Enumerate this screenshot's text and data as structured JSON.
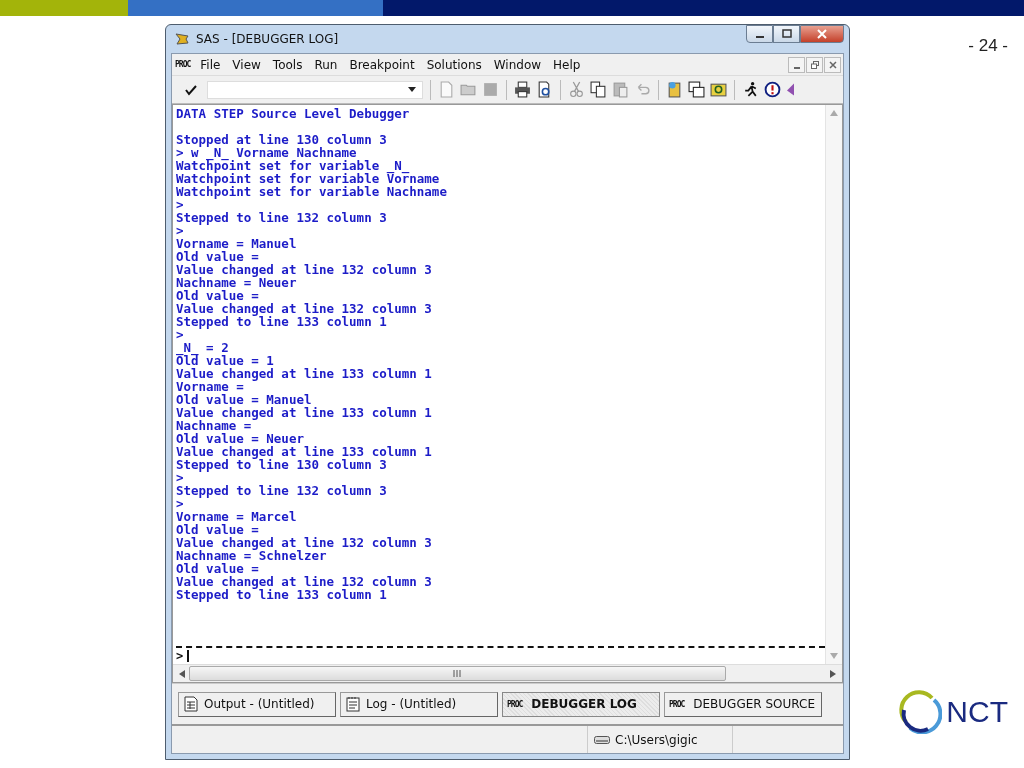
{
  "slide": {
    "page_number": "- 24 -",
    "logo_text": "NCT"
  },
  "window": {
    "title": "SAS - [DEBUGGER LOG]"
  },
  "menu": {
    "icon_label": "PROC",
    "items": [
      "File",
      "View",
      "Tools",
      "Run",
      "Breakpoint",
      "Solutions",
      "Window",
      "Help"
    ]
  },
  "log": {
    "header": "DATA STEP Source Level Debugger",
    "lines": [
      "Stopped at line 130 column 3",
      "> w _N_ Vorname Nachname",
      "Watchpoint set for variable _N_",
      "Watchpoint set for variable Vorname",
      "Watchpoint set for variable Nachname",
      ">",
      "Stepped to line 132 column 3",
      ">",
      "Vorname = Manuel",
      "Old value =",
      "Value changed at line 132 column 3",
      "Nachname = Neuer",
      "Old value =",
      "Value changed at line 132 column 3",
      "Stepped to line 133 column 1",
      ">",
      "_N_ = 2",
      "Old value = 1",
      "Value changed at line 133 column 1",
      "Vorname =",
      "Old value = Manuel",
      "Value changed at line 133 column 1",
      "Nachname =",
      "Old value = Neuer",
      "Value changed at line 133 column 1",
      "Stepped to line 130 column 3",
      ">",
      "Stepped to line 132 column 3",
      ">",
      "Vorname = Marcel",
      "Old value =",
      "Value changed at line 132 column 3",
      "Nachname = Schnelzer",
      "Old value =",
      "Value changed at line 132 column 3",
      "Stepped to line 133 column 1"
    ],
    "prompt": ">"
  },
  "tabs": [
    {
      "label": "Output - (Untitled)",
      "kind": "output",
      "selected": false
    },
    {
      "label": "Log - (Untitled)",
      "kind": "log",
      "selected": false
    },
    {
      "label": "DEBUGGER LOG",
      "kind": "proc",
      "icon_label": "PROC",
      "selected": true
    },
    {
      "label": "DEBUGGER SOURCE",
      "kind": "proc",
      "icon_label": "PROC",
      "selected": false
    }
  ],
  "status_bar": {
    "path": "C:\\Users\\gigic"
  }
}
